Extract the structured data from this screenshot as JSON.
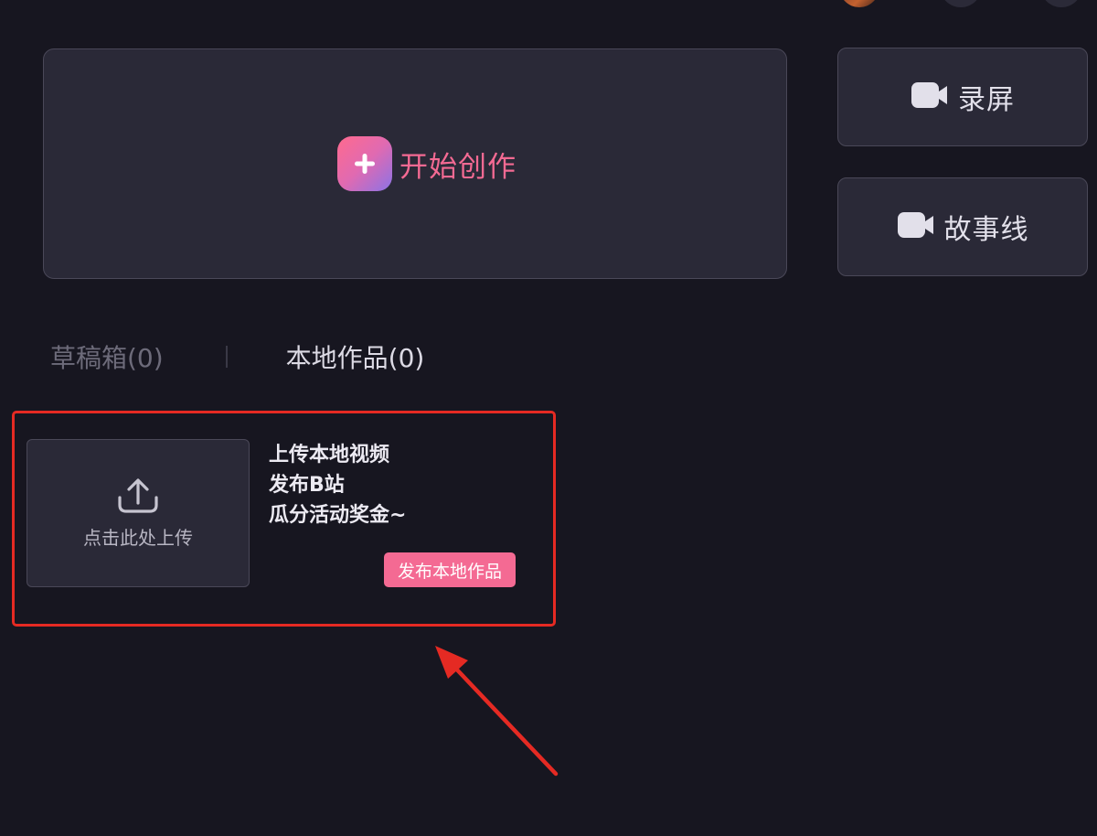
{
  "create": {
    "label": "开始创作"
  },
  "side_buttons": {
    "record": {
      "label": "录屏"
    },
    "storyline": {
      "label": "故事线"
    }
  },
  "tabs": {
    "drafts": "草稿箱(0)",
    "local_works": "本地作品(0)"
  },
  "upload": {
    "prompt": "点击此处上传",
    "promo_lines": [
      "上传本地视频",
      "发布B站",
      "瓜分活动奖金~"
    ],
    "publish_button": "发布本地作品"
  },
  "colors": {
    "accent_pink": "#f46a93",
    "highlight_red": "#e52a23",
    "background": "#171620",
    "card": "#2a2937"
  },
  "icons": [
    "plus-icon",
    "camera-icon",
    "upload-icon",
    "arrow-annotation"
  ]
}
